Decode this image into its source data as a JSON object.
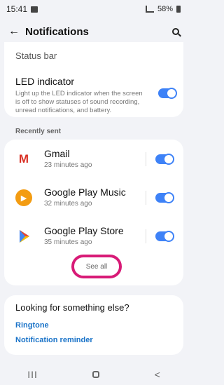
{
  "status_bar": {
    "time": "15:41",
    "battery": "58%"
  },
  "header": {
    "title": "Notifications"
  },
  "settings": {
    "status_bar_label": "Status bar",
    "led_title": "LED indicator",
    "led_description": "Light up the LED indicator when the screen is off to show statuses of sound recording, unread notifications, and battery."
  },
  "recently_sent": {
    "section_title": "Recently sent",
    "apps": [
      {
        "name": "Gmail",
        "time": "23 minutes ago",
        "enabled": true
      },
      {
        "name": "Google Play Music",
        "time": "32 minutes ago",
        "enabled": true
      },
      {
        "name": "Google Play Store",
        "time": "35 minutes ago",
        "enabled": true
      }
    ],
    "see_all_label": "See all"
  },
  "looking_for": {
    "title": "Looking for something else?",
    "links": [
      "Ringtone",
      "Notification reminder"
    ]
  },
  "navbar": {
    "recents": "III",
    "back": "<"
  },
  "colors": {
    "accent": "#3e82f7",
    "highlight": "#d81b77",
    "link": "#1a73c8"
  }
}
